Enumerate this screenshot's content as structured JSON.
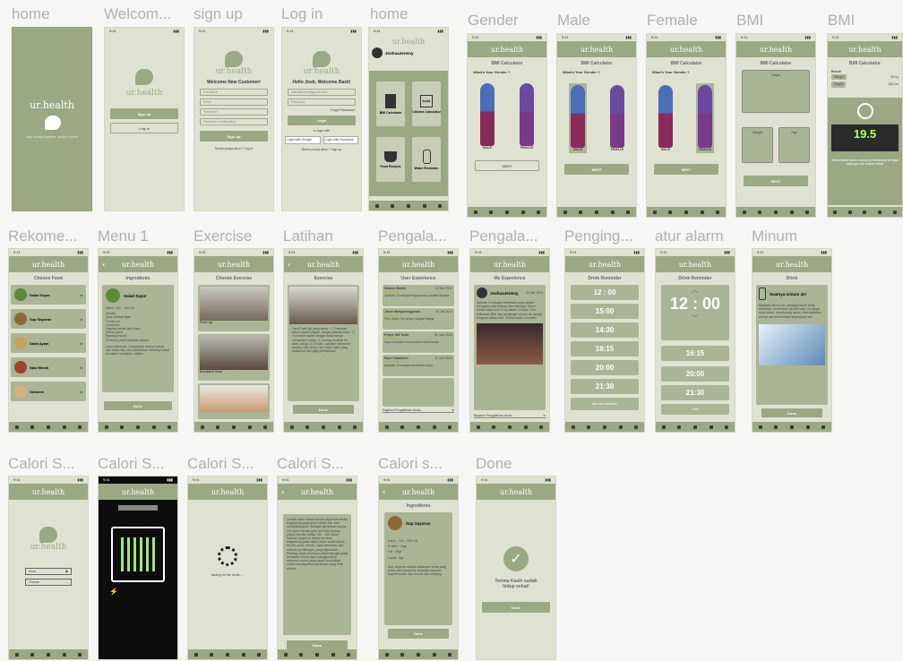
{
  "labels": [
    "home",
    "Welcom...",
    "sign up",
    "Log in",
    "home",
    "Gender",
    "Male",
    "Female",
    "BMI",
    "BMI",
    "Rekome...",
    "Menu 1",
    "Exercise",
    "Latihan",
    "Pengala...",
    "Pengala...",
    "Penging...",
    "atur alarm",
    "Minum",
    "Calori S...",
    "Calori S...",
    "Calori S...",
    "Calori S...",
    "Calori s...",
    "Done"
  ],
  "app": {
    "name": "ur.health",
    "tagline": "Stay healthy together, healthy forever",
    "time": "9:41"
  },
  "welcome": {
    "signup": "Sign Up",
    "login": "Log in"
  },
  "signup": {
    "title": "Welcome New Customer!",
    "fields": [
      "Full Name",
      "Email",
      "Password",
      "Password Confirmation"
    ],
    "button": "Sign Up",
    "footer": "Sudah punya akun ? Log in"
  },
  "login": {
    "title": "Hello Josh, Welcome Back!",
    "fields": [
      "joshuajeremy@gmail.com",
      "Password"
    ],
    "forgot": "Forgot Password?",
    "button": "Login",
    "or": "or login with",
    "google": "Login with Google",
    "facebook": "Login with Facebook",
    "footer": "Belum punya akun ? Sign up"
  },
  "home": {
    "user": "JoshuaJeremy",
    "tiles": [
      "BMI Calculator",
      "Calories Calculator",
      "Food Recipes",
      "Water Reminder"
    ],
    "kcal": "kcal"
  },
  "gender": {
    "title": "BMI Calculator",
    "question": "What's Your Gender ?",
    "male": "MALE",
    "female": "FEMALE",
    "next": "NEXT"
  },
  "bmi": {
    "title": "BMI Calculator",
    "height": "Height",
    "weight": "Weight",
    "age": "Age",
    "next": "NEXT",
    "result": "Result",
    "weight_val": "49 kg",
    "height_val": "160 cm",
    "score": "19.5",
    "advice": "Berat badan kamu normal, pertahankan dengan olahraga dan makan sehat"
  },
  "food": {
    "title": "Choose Food",
    "items": [
      "Salad Sayur",
      "Sup Sayuran",
      "Dada Ayam",
      "Nasi Merah",
      "Oatmeal"
    ]
  },
  "ingredients": {
    "title": "Ingredients",
    "dish": "Salad Sayur",
    "kcal": "Kalori: 100 - 150 Cal",
    "list": [
      "Selada",
      "Daun selada hijau",
      "Tomat ceri",
      "Cucumber",
      "Paprika merah atau hijau",
      "Wortel parut",
      "Bawang merah",
      "Dressing salad (minyak zaitun)"
    ],
    "note": "Cara membuat: Campurkan semua bahan dan aduk rata, lalu tambahkan dressing salad ke dalam mangkuk, sajikan.",
    "done": "Done"
  },
  "exercise": {
    "title": "Choose Exercise",
    "items": [
      "Push up",
      "Dumbbell rows",
      ""
    ]
  },
  "latihan": {
    "title": "Exercise",
    "steps": "Cara Push Up yang benar: 1. Posisikan tubuh seperti papan, tangan selebar bahu. 2. Turunkan badan hingga dada hampir menyentuh lantai. 3. Dorong kembali ke atas, ulangi 10-15 kali. Lakukan latihan ini secara rutin setiap hari untuk hasil yang maksimal dan jaga pernapasan.",
    "done": "Done"
  },
  "ux": {
    "title": "User Experience",
    "entries": [
      {
        "name": "Shalom Banks",
        "date": "12 Mei 2023",
        "text": "Aplikasi ini sangat berguna dan mudah dipakai"
      },
      {
        "name": "Jason Mangaranggondo",
        "date": "20 Juli 2023",
        "text": "Fitur Water Reminder sangat bagus"
      },
      {
        "name": "Prayer SM Tarak",
        "date": "01 Juni 2023",
        "text": "Saya berhasil menurunkan berat badan"
      },
      {
        "name": "Ryan Sidabuton",
        "date": "11 Juni 2023",
        "text": "Aplikasi ini sangat membantu saya"
      }
    ],
    "input": "Bagikan Pengalaman Anda..."
  },
  "myexp": {
    "title": "My Experience",
    "user": "JoshuaJeremy",
    "date": "24 Mei 2023",
    "text": "Aplikasi ini sangat membantu saya dalam mengatur pola makan dan olahraga. Berat badan saya turun 5 kg dalam 2 bulan. Fitur kalkulator BMI dan pengingat minum air sangat berguna setiap hari. Terima kasih ur.health!",
    "input": "Bagikan Pengalaman Anda..."
  },
  "drink": {
    "title": "Drink Reminder",
    "times": [
      "12 : 00",
      "15:00",
      "14:30",
      "16:15",
      "20:00",
      "21:30"
    ],
    "add": "add new reminder",
    "big": "12 : 00",
    "alarm_times": [
      "16:15",
      "20:00",
      "21:30"
    ],
    "done": "Done"
  },
  "minum": {
    "title": "Drink",
    "msg": "Saatnya minum air!",
    "tips": "Manfaat minum air: menjaga tubuh tetap terhidrasi, membantu pencernaan, menjaga suhu tubuh, membuang racun, meningkatkan energi dan konsentrasi sepanjang hari.",
    "done": "Done"
  },
  "calori": {
    "scan": "Scan",
    "choose": "Choose",
    "loading": "loading for the result.....",
    "result": "Jumlah kalori dalam benda dapat bervariasi tergantung pada jenis benda dan cara menghitungnya. Sebagai gambaran umum, 100 gram benda putih memiliki kisaran yang memiliki sekitar 130 - 150 kalori. Sebuah angka ini dapat berubah tergantung pada faktor faktor seperti jenis benda, porsi, merek, cara memasak, dan metode perhitungan yang digunakan. Penting untuk membaca informasi gizi pada kemasan benda atau menggunakan referensi nutrisi yang dapat diandalkan untuk mendapatkan perkiraan yang lebih akurat.",
    "done": "Done",
    "ingredients": "Ingredients",
    "dish": "Sup Sayuran",
    "facts": [
      "Kalori : 100 - 150 Cal",
      "Protein : 10gr",
      "Fat : 20gr",
      "Carbs : 5gr"
    ],
    "note": "Sup Sayuran adalah hidangan sehat yang terdiri dari campuran berbagai sayuran seperti wortel, kol, buncis dan kentang."
  },
  "done": {
    "msg": "Terima Kasih sudah hidup sehat!",
    "button": "Done"
  }
}
